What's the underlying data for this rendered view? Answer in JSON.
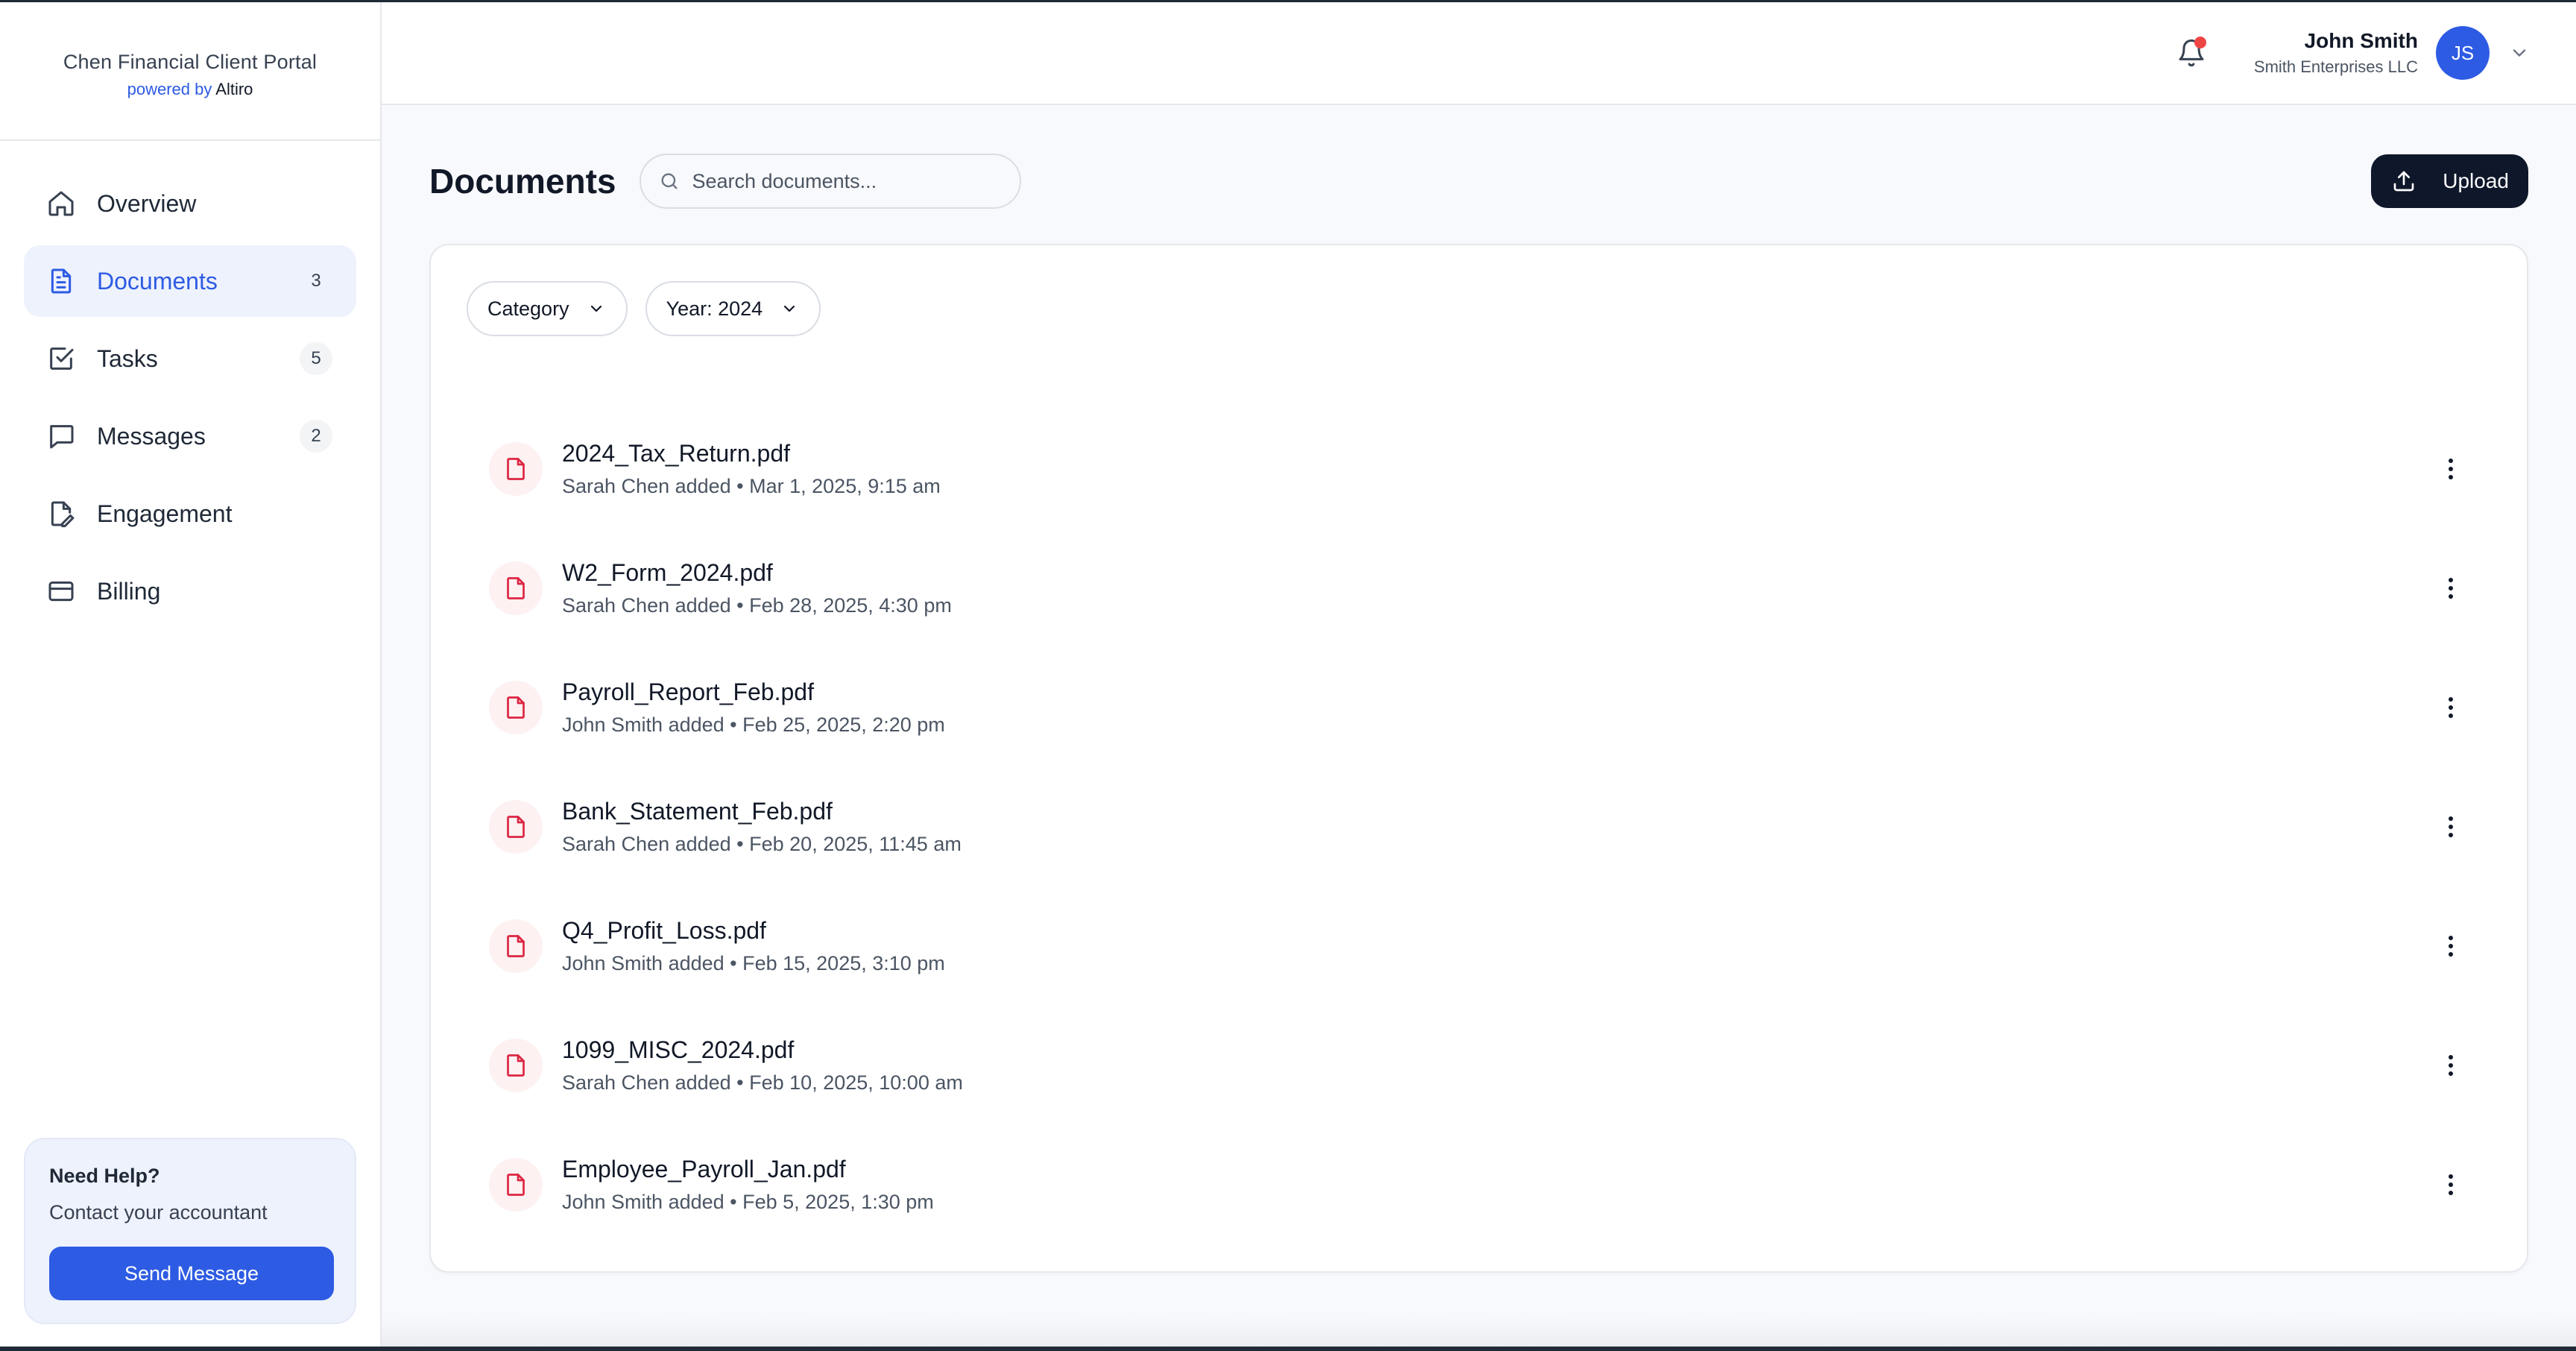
{
  "brand": {
    "title": "Chen Financial Client Portal",
    "powered_prefix": "powered by",
    "powered_name": "Altiro"
  },
  "nav": [
    {
      "label": "Overview",
      "icon": "home-icon",
      "badge": null,
      "active": false
    },
    {
      "label": "Documents",
      "icon": "document-icon",
      "badge": "3",
      "active": true
    },
    {
      "label": "Tasks",
      "icon": "checkbox-icon",
      "badge": "5",
      "active": false
    },
    {
      "label": "Messages",
      "icon": "chat-icon",
      "badge": "2",
      "active": false
    },
    {
      "label": "Engagement",
      "icon": "edit-document-icon",
      "badge": null,
      "active": false
    },
    {
      "label": "Billing",
      "icon": "credit-card-icon",
      "badge": null,
      "active": false
    }
  ],
  "help": {
    "title": "Need Help?",
    "text": "Contact your accountant",
    "button": "Send Message"
  },
  "user": {
    "name": "John Smith",
    "company": "Smith Enterprises LLC",
    "initials": "JS"
  },
  "page": {
    "title": "Documents",
    "search_placeholder": "Search documents...",
    "upload_label": "Upload"
  },
  "filters": {
    "category": "Category",
    "year": "Year: 2024"
  },
  "documents": [
    {
      "name": "2024_Tax_Return.pdf",
      "meta": "Sarah Chen added • Mar 1, 2025, 9:15 am"
    },
    {
      "name": "W2_Form_2024.pdf",
      "meta": "Sarah Chen added • Feb 28, 2025, 4:30 pm"
    },
    {
      "name": "Payroll_Report_Feb.pdf",
      "meta": "John Smith added • Feb 25, 2025, 2:20 pm"
    },
    {
      "name": "Bank_Statement_Feb.pdf",
      "meta": "Sarah Chen added • Feb 20, 2025, 11:45 am"
    },
    {
      "name": "Q4_Profit_Loss.pdf",
      "meta": "John Smith added • Feb 15, 2025, 3:10 pm"
    },
    {
      "name": "1099_MISC_2024.pdf",
      "meta": "Sarah Chen added • Feb 10, 2025, 10:00 am"
    },
    {
      "name": "Employee_Payroll_Jan.pdf",
      "meta": "John Smith added • Feb 5, 2025, 1:30 pm"
    }
  ],
  "colors": {
    "accent": "#2d5be3",
    "dark_button": "#0f172a",
    "pdf_red": "#dc2643",
    "notification": "#ef4444"
  }
}
